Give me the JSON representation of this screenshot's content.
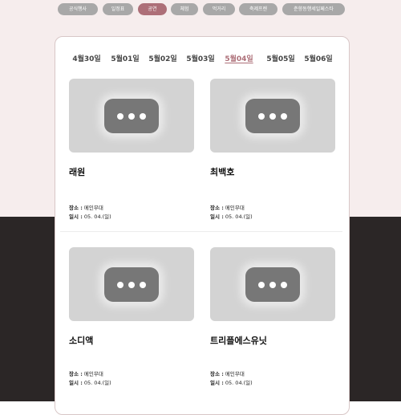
{
  "categories": [
    {
      "label": "공식행사",
      "active": false
    },
    {
      "label": "일정표",
      "active": false
    },
    {
      "label": "공연",
      "active": true
    },
    {
      "label": "체험",
      "active": false
    },
    {
      "label": "먹거리",
      "active": false
    },
    {
      "label": "축제프렌",
      "active": false
    },
    {
      "label": "춘향동행세일페스타",
      "active": false
    }
  ],
  "dates": [
    {
      "label": "4월30일",
      "active": false
    },
    {
      "label": "5월01일",
      "active": false
    },
    {
      "label": "5월02일",
      "active": false
    },
    {
      "label": "5월03일",
      "active": false
    },
    {
      "label": "5월04일",
      "active": true
    },
    {
      "label": "5월05일",
      "active": false
    },
    {
      "label": "5월06일",
      "active": false
    }
  ],
  "performances": [
    {
      "name": "래원",
      "venue_label": "장소 :",
      "venue": "메인무대",
      "date_label": "일시 :",
      "date": "05. 04.(일)"
    },
    {
      "name": "최백호",
      "venue_label": "장소 :",
      "venue": "메인무대",
      "date_label": "일시 :",
      "date": "05. 04.(일)"
    },
    {
      "name": "소디액",
      "venue_label": "장소 :",
      "venue": "메인무대",
      "date_label": "일시 :",
      "date": "05. 04.(일)"
    },
    {
      "name": "트리플에스유닛",
      "venue_label": "장소 :",
      "venue": "메인무대",
      "date_label": "일시 :",
      "date": "05. 04.(일)"
    }
  ],
  "icons": {
    "thumbnail": "more-dots-icon"
  },
  "colors": {
    "accent": "#ad6f78",
    "pill_inactive": "#a8a8a8",
    "thumbnail": "#d3d3d3"
  }
}
